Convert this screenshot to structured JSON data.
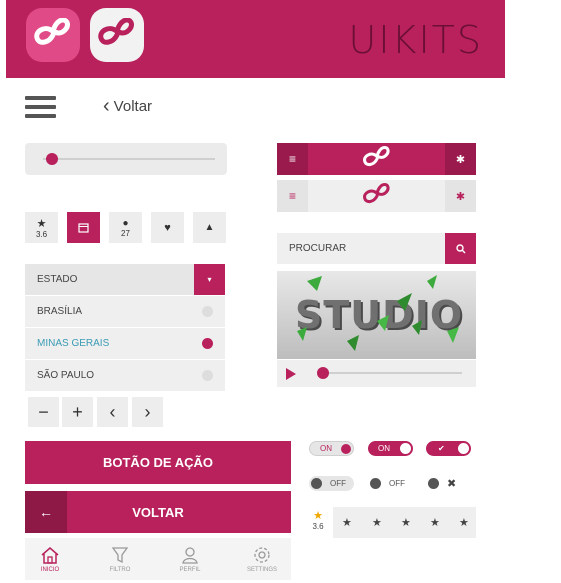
{
  "header": {
    "title": "UIKITS"
  },
  "nav": {
    "back_label": "Voltar"
  },
  "slider": {
    "value": 0.05
  },
  "icon_tiles": [
    {
      "icon": "star-icon",
      "value": "3.6"
    },
    {
      "icon": "calendar-icon",
      "value": ""
    },
    {
      "icon": "comment-icon",
      "value": "27"
    },
    {
      "icon": "heart-icon",
      "value": ""
    },
    {
      "icon": "thumbs-up-icon",
      "value": ""
    }
  ],
  "dropdown": {
    "label": "ESTADO",
    "options": [
      {
        "label": "BRASÍLIA",
        "selected": false
      },
      {
        "label": "MINAS GERAIS",
        "selected": true
      },
      {
        "label": "SÃO PAULO",
        "selected": false
      }
    ]
  },
  "controls": {
    "minus": "−",
    "plus": "+",
    "prev": "‹",
    "next": "›"
  },
  "buttons": {
    "action_label": "BOTÃO DE AÇÃO",
    "back_label": "VOLTAR"
  },
  "tabbar": [
    {
      "icon": "home-icon",
      "label": "INICIO"
    },
    {
      "icon": "filter-icon",
      "label": "FILTRO"
    },
    {
      "icon": "user-icon",
      "label": "PERFIL"
    },
    {
      "icon": "gear-icon",
      "label": "SETTINGS"
    }
  ],
  "search": {
    "placeholder": "PROCURAR"
  },
  "video": {
    "title_text": "STUDIO"
  },
  "toggles": {
    "on_label": "ON",
    "off_label": "OFF"
  },
  "rating": {
    "value": "3.6"
  },
  "colors": {
    "accent": "#b8215c",
    "header": "#b8215c",
    "muted": "#efefef",
    "link": "#3a9bb5"
  }
}
